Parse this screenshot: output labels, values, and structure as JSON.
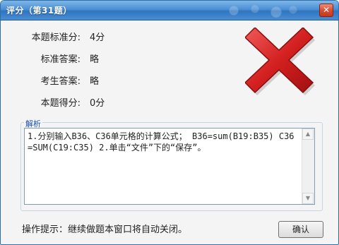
{
  "window": {
    "title": "评分（第31题）",
    "close_glyph": "✕"
  },
  "fields": [
    {
      "label": "本题标准分:",
      "value": "4分"
    },
    {
      "label": "标准答案:",
      "value": "略"
    },
    {
      "label": "考生答案:",
      "value": "略"
    },
    {
      "label": "本题得分:",
      "value": "0分"
    }
  ],
  "result_icon": "red-x-icon",
  "analysis": {
    "label": "解析",
    "text": "1.分别输入B36、C36单元格的计算公式； B36=sum(B19:B35) C36=SUM(C19:C35) 2.单击“文件”下的“保存”。"
  },
  "footer": {
    "hint": "操作提示：继续做题本窗口将自动关闭。",
    "ok_label": "确认"
  },
  "colors": {
    "titlebar": "#4b8fd4",
    "x_mark": "#c81e1e"
  }
}
